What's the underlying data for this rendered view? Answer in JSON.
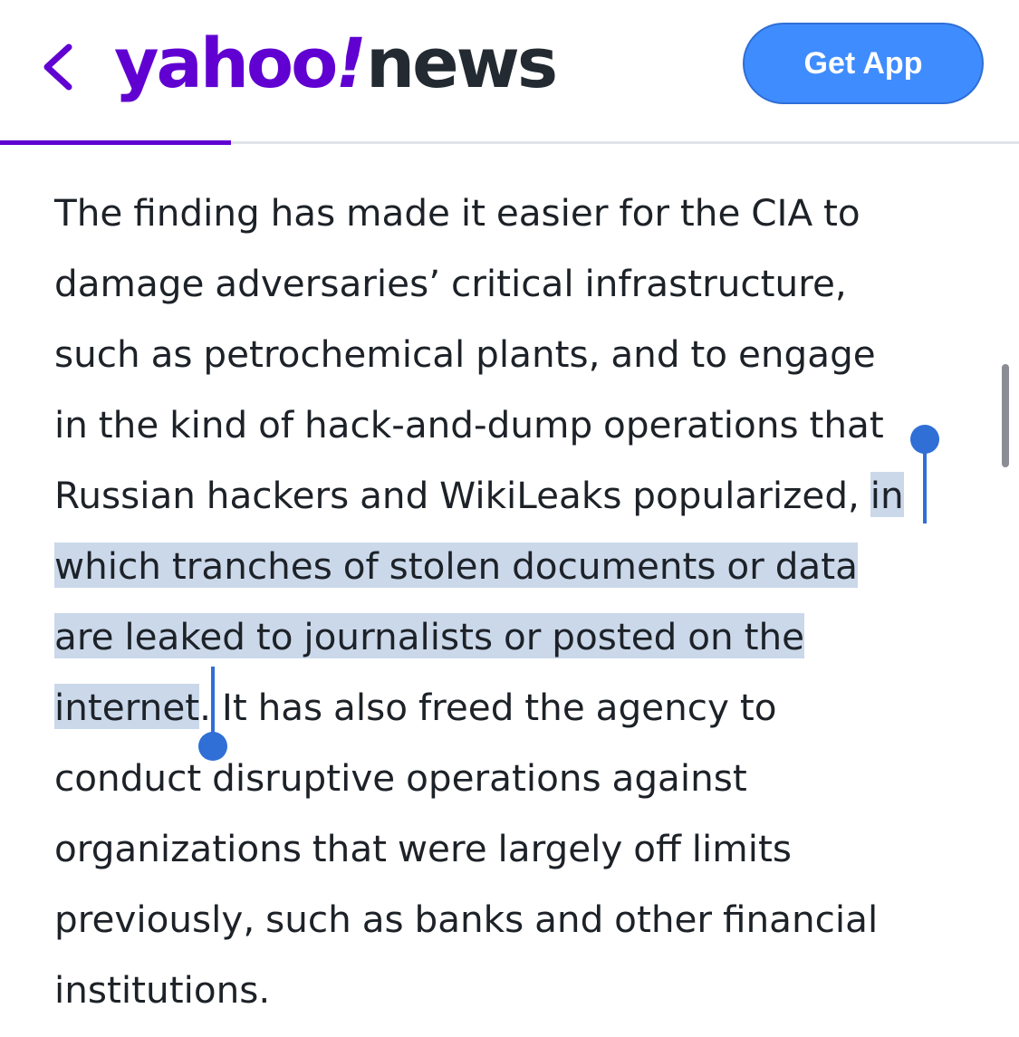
{
  "header": {
    "logo_brand": "yahoo",
    "logo_bang": "!",
    "logo_section": "news",
    "get_app_label": "Get App",
    "back_icon": "chevron-left-icon"
  },
  "reading_progress": 0.227,
  "colors": {
    "brand_purple": "#6001d2",
    "button_blue": "#3f8cff",
    "selection_bg": "#cad8ea",
    "selection_handle": "#2f6fd6",
    "text": "#1d2228"
  },
  "article": {
    "lines": [
      {
        "pre": "The finding has made it easier for the CIA to",
        "sel": "",
        "post": ""
      },
      {
        "pre": "damage adversaries’ critical infrastructure,",
        "sel": "",
        "post": ""
      },
      {
        "pre": "such as petrochemical plants, and to engage",
        "sel": "",
        "post": ""
      },
      {
        "pre": "in the kind of hack-and-dump operations that",
        "sel": "",
        "post": ""
      },
      {
        "pre": "Russian hackers and WikiLeaks popularized, ",
        "sel": "in",
        "post": ""
      },
      {
        "pre": "",
        "sel": "which tranches of stolen documents or data",
        "post": ""
      },
      {
        "pre": "",
        "sel": "are leaked to journalists or posted on the",
        "post": ""
      },
      {
        "pre": "",
        "sel": "internet",
        "post": ". It has also freed the agency to"
      },
      {
        "pre": "conduct disruptive operations against",
        "sel": "",
        "post": ""
      },
      {
        "pre": "organizations that were largely off limits",
        "sel": "",
        "post": ""
      },
      {
        "pre": "previously, such as banks and other financial",
        "sel": "",
        "post": ""
      },
      {
        "pre": "institutions.",
        "sel": "",
        "post": ""
      }
    ]
  }
}
